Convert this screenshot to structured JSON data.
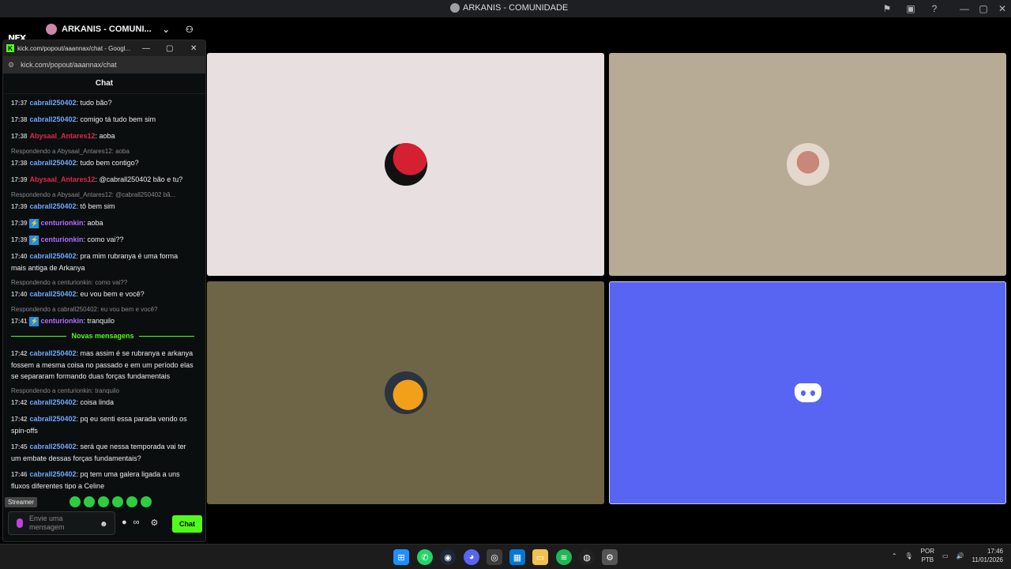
{
  "window": {
    "title": "ARKANIS - COMUNIDADE",
    "controls": [
      "—",
      "▢",
      "✕"
    ]
  },
  "server": {
    "name": "ARKANIS - COMUNI...",
    "logo_text": "NFX"
  },
  "popup": {
    "title": "kick.com/popout/aaannax/chat - Googl...",
    "url": "kick.com/popout/aaannax/chat",
    "header": "Chat"
  },
  "chat": {
    "messages": [
      {
        "time": "17:37",
        "user": "cabrall250402",
        "color": "#6ea8ff",
        "text": ": tudo bão?"
      },
      {
        "time": "17:38",
        "user": "cabrall250402",
        "color": "#6ea8ff",
        "text": ": comigo tá tudo bem sim"
      },
      {
        "time": "17:38",
        "user": "Abysaal_Antares12",
        "color": "#e0284a",
        "text": ": aoba"
      },
      {
        "reply": "Respondendo a Abysaal_Antares12: aoba",
        "time": "17:38",
        "user": "cabrall250402",
        "color": "#6ea8ff",
        "text": ": tudo bem contigo?"
      },
      {
        "time": "17:39",
        "user": "Abysaal_Antares12",
        "color": "#e0284a",
        "text": ": @cabrall250402 bão e tu?"
      },
      {
        "reply": "Respondendo a Abysaal_Antares12: @cabrall250402 bã...",
        "time": "17:39",
        "user": "cabrall250402",
        "color": "#6ea8ff",
        "text": ": tô bem sim"
      },
      {
        "time": "17:39",
        "user": "centurionkin",
        "color": "#b06cff",
        "badge": true,
        "text": ": aoba"
      },
      {
        "time": "17:39",
        "user": "centurionkin",
        "color": "#b06cff",
        "badge": true,
        "text": ": como vai??"
      },
      {
        "time": "17:40",
        "user": "cabrall250402",
        "color": "#6ea8ff",
        "text": ": pra mim rubranya é uma forma mais antiga de Arkanya"
      },
      {
        "reply": "Respondendo a centurionkin: como vai??",
        "time": "17:40",
        "user": "cabrall250402",
        "color": "#6ea8ff",
        "text": ": eu vou bem e você?"
      },
      {
        "reply": "Respondendo a cabrall250402: eu vou bem e você?",
        "time": "17:41",
        "user": "centurionkin",
        "color": "#b06cff",
        "badge": true,
        "text": ": tranquilo"
      }
    ],
    "divider": "Novas mensagens",
    "new_messages": [
      {
        "time": "17:42",
        "user": "cabrall250402",
        "color": "#6ea8ff",
        "text": ": mas assim é se rubranya e arkanya fossem a mesma coisa no passado e em um período elas se separaram formando duas forças fundamentais"
      },
      {
        "reply": "Respondendo a centurionkin: tranquilo",
        "time": "17:42",
        "user": "cabrall250402",
        "color": "#6ea8ff",
        "text": ": coisa linda"
      },
      {
        "time": "17:42",
        "user": "cabrall250402",
        "color": "#6ea8ff",
        "text": ": pq eu senti essa parada vendo os spin-offs"
      },
      {
        "time": "17:45",
        "user": "cabrall250402",
        "color": "#6ea8ff",
        "text": ": será que nessa temporada vai ter um embate dessas forças fundamentais?"
      },
      {
        "time": "17:46",
        "user": "cabrall250402",
        "color": "#6ea8ff",
        "text": ": pq tem uma galera ligada a uns fluxos diferentes tipo a Celine"
      }
    ],
    "streamer_tooltip": "Streamer",
    "input_placeholder": "Envie uma mensagem",
    "send_label": "Chat"
  },
  "stage": {
    "tiles": [
      {
        "bg": "#e8e0e0"
      },
      {
        "bg": "#b8ab96"
      },
      {
        "bg": "#6e6446"
      },
      {
        "bg": "#5865f2"
      }
    ]
  },
  "taskbar": {
    "language": "POR",
    "layout": "PTB",
    "time": "17:46",
    "date": "11/01/2026"
  }
}
